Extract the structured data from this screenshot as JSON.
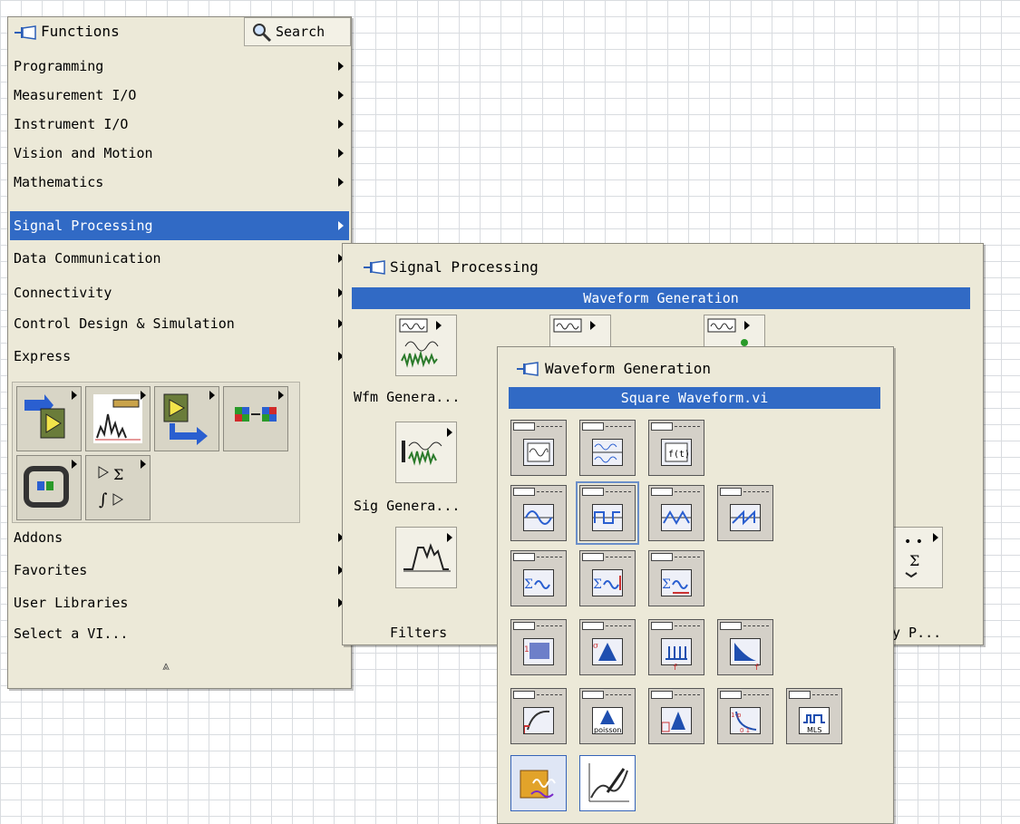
{
  "functions_palette": {
    "title": "Functions",
    "search_label": "Search",
    "categories": [
      {
        "label": "Programming",
        "has_submenu": true
      },
      {
        "label": "Measurement I/O",
        "has_submenu": true
      },
      {
        "label": "Instrument I/O",
        "has_submenu": true
      },
      {
        "label": "Vision and Motion",
        "has_submenu": true
      },
      {
        "label": "Mathematics",
        "has_submenu": true
      },
      {
        "label": "Signal Processing",
        "has_submenu": true,
        "selected": true
      },
      {
        "label": "Data Communication",
        "has_submenu": true
      },
      {
        "label": "Connectivity",
        "has_submenu": true
      },
      {
        "label": "Control Design & Simulation",
        "has_submenu": true
      },
      {
        "label": "Express",
        "has_submenu": true
      }
    ],
    "icon_tiles": [
      "express-input-icon",
      "express-analysis-icon",
      "express-output-icon",
      "express-signal-manipulation-icon",
      "express-exec-control-icon",
      "express-arithmetic-icon"
    ],
    "bottom_items": [
      {
        "label": "Addons",
        "has_submenu": true
      },
      {
        "label": "Favorites",
        "has_submenu": true
      },
      {
        "label": "User Libraries",
        "has_submenu": true
      },
      {
        "label": "Select a VI...",
        "has_submenu": false
      }
    ],
    "collapse_glyph": "⩓"
  },
  "signal_processing_palette": {
    "title": "Signal Processing",
    "highlight_bar": "Waveform Generation",
    "items": [
      {
        "label": "Wfm Genera...",
        "icon": "waveform-generation-icon"
      },
      {
        "label": "Sig Genera...",
        "icon": "signal-generation-icon"
      },
      {
        "label": "Filters",
        "icon": "filters-icon"
      },
      {
        "label": "y P...",
        "icon": "point-by-point-icon"
      }
    ]
  },
  "waveform_generation_palette": {
    "title": "Waveform Generation",
    "highlight_bar": "Square Waveform.vi",
    "rows": [
      [
        "basic-function-generator-icon",
        "basic-multitone-icon",
        "formula-waveform-icon"
      ],
      [
        "sine-waveform-icon",
        "square-waveform-icon",
        "triangle-waveform-icon",
        "sawtooth-waveform-icon"
      ],
      [
        "basic-multitone-waveform-icon",
        "multitone-amplitude-icon",
        "multitone-freq-icon"
      ],
      [
        "uniform-white-noise-icon",
        "gaussian-white-noise-icon",
        "periodic-random-noise-icon",
        "inverse-f-noise-icon"
      ],
      [
        "gamma-noise-icon",
        "poisson-noise-icon",
        "binomial-noise-icon",
        "bernoulli-noise-icon",
        "mls-sequence-icon"
      ],
      [
        "simulate-signal-express-icon",
        "create-waveform-express-icon"
      ]
    ],
    "icon_texts": {
      "formula": "f(t)",
      "poisson": "poisson",
      "mls": "MLS",
      "f": "f"
    },
    "selected_item": "square-waveform-icon"
  },
  "colors": {
    "palette_bg": "#ece9d8",
    "selection": "#316ac5",
    "grid": "#d9dce0"
  }
}
